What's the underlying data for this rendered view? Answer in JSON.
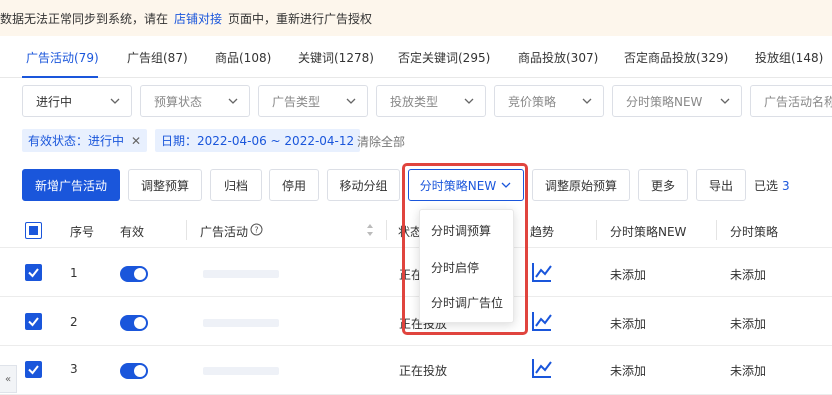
{
  "notice": {
    "text_before": "数据无法正常同步到系统，请在",
    "link": "店铺对接",
    "text_after": "页面中，重新进行广告授权"
  },
  "tabs": [
    {
      "label": "广告活动(79)",
      "active": true
    },
    {
      "label": "广告组(87)"
    },
    {
      "label": "商品(108)"
    },
    {
      "label": "关键词(1278)"
    },
    {
      "label": "否定关键词(295)"
    },
    {
      "label": "商品投放(307)"
    },
    {
      "label": "否定商品投放(329)"
    },
    {
      "label": "投放组(148)"
    }
  ],
  "filters": [
    "进行中",
    "预算状态",
    "广告类型",
    "投放类型",
    "竞价策略",
    "分时策略NEW",
    "广告活动名称"
  ],
  "tags": [
    {
      "label": "有效状态：进行中"
    },
    {
      "label": "日期：2022-04-06 ~ 2022-04-12"
    }
  ],
  "clear_all": "清除全部",
  "toolbar": {
    "new_campaign": "新增广告活动",
    "adjust_budget": "调整预算",
    "archive": "归档",
    "pause": "停用",
    "move_group": "移动分组",
    "time_strategy": "分时策略NEW",
    "adjust_original_budget": "调整原始预算",
    "more": "更多",
    "export": "导出",
    "selected_label": "已选",
    "selected_count": "3"
  },
  "dropdown": {
    "items": [
      "分时调预算",
      "分时启停",
      "分时调广告位"
    ]
  },
  "table": {
    "headers": {
      "index": "序号",
      "active": "有效",
      "campaign": "广告活动",
      "status": "状态",
      "trend": "趋势",
      "time_strategy_new": "分时策略NEW",
      "time_strategy": "分时策略"
    },
    "rows": [
      {
        "index": "1",
        "status": "正在投放",
        "time_strategy_new": "未添加",
        "time_strategy": "未添加"
      },
      {
        "index": "2",
        "status": "正在投放",
        "time_strategy_new": "未添加",
        "time_strategy": "未添加"
      },
      {
        "index": "3",
        "status": "正在投放",
        "time_strategy_new": "未添加",
        "time_strategy": "未添加"
      }
    ]
  },
  "colors": {
    "accent": "#1a56db",
    "highlight": "#e0443e"
  }
}
